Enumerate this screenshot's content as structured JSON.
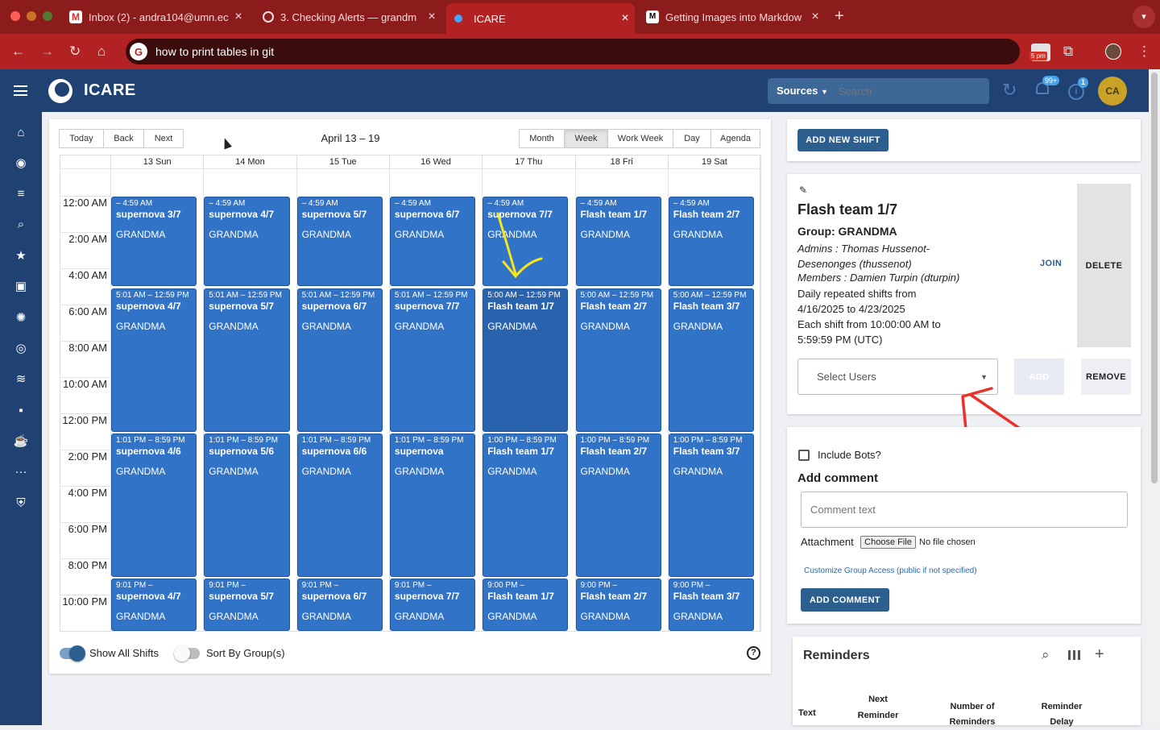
{
  "browser": {
    "tabs": [
      {
        "title": "Inbox (2) - andra104@umn.ec",
        "icon": "gmail-icon"
      },
      {
        "title": "3. Checking Alerts — grandm",
        "icon": "globe-icon"
      },
      {
        "title": "ICARE",
        "icon": "icare-icon"
      },
      {
        "title": "Getting Images into Markdow",
        "icon": "medium-icon"
      }
    ],
    "omnibox": "how to print tables in git",
    "omnibox_badge": "5 pm",
    "colors": {
      "frame": "#8c1c1c",
      "toolbar": "#b22222"
    }
  },
  "app": {
    "name": "ICARE",
    "sources_label": "Sources",
    "search_placeholder": "Search",
    "notifications_badge": "99+",
    "info_badge": "1",
    "avatar_initials": "CA",
    "colors": {
      "header": "#1f4272",
      "event": "#3173c6",
      "avatar": "#c9a227"
    }
  },
  "calendar": {
    "toolbar": {
      "today": "Today",
      "back": "Back",
      "next": "Next",
      "range": "April 13 – 19"
    },
    "views": [
      "Month",
      "Week",
      "Work Week",
      "Day",
      "Agenda"
    ],
    "active_view": "Week",
    "days": [
      "13 Sun",
      "14 Mon",
      "15 Tue",
      "16 Wed",
      "17 Thu",
      "18 Fri",
      "19 Sat"
    ],
    "times": [
      "12:00 AM",
      "2:00 AM",
      "4:00 AM",
      "6:00 AM",
      "8:00 AM",
      "10:00 AM",
      "12:00 PM",
      "2:00 PM",
      "4:00 PM",
      "6:00 PM",
      "8:00 PM",
      "10:00 PM"
    ],
    "events": [
      [
        {
          "time": "– 4:59 AM",
          "name": "supernova 3/7",
          "group": "GRANDMA"
        },
        {
          "time": "5:01 AM – 12:59 PM",
          "name": "supernova 4/7",
          "group": "GRANDMA"
        },
        {
          "time": "1:01 PM – 8:59 PM",
          "name": "supernova 4/6",
          "group": "GRANDMA"
        },
        {
          "time": "9:01 PM –",
          "name": "supernova 4/7",
          "group": "GRANDMA"
        }
      ],
      [
        {
          "time": "– 4:59 AM",
          "name": "supernova 4/7",
          "group": "GRANDMA"
        },
        {
          "time": "5:01 AM – 12:59 PM",
          "name": "supernova 5/7",
          "group": "GRANDMA"
        },
        {
          "time": "1:01 PM – 8:59 PM",
          "name": "supernova 5/6",
          "group": "GRANDMA"
        },
        {
          "time": "9:01 PM –",
          "name": "supernova 5/7",
          "group": "GRANDMA"
        }
      ],
      [
        {
          "time": "– 4:59 AM",
          "name": "supernova 5/7",
          "group": "GRANDMA"
        },
        {
          "time": "5:01 AM – 12:59 PM",
          "name": "supernova 6/7",
          "group": "GRANDMA"
        },
        {
          "time": "1:01 PM – 8:59 PM",
          "name": "supernova 6/6",
          "group": "GRANDMA"
        },
        {
          "time": "9:01 PM –",
          "name": "supernova 6/7",
          "group": "GRANDMA"
        }
      ],
      [
        {
          "time": "– 4:59 AM",
          "name": "supernova 6/7",
          "group": "GRANDMA"
        },
        {
          "time": "5:01 AM – 12:59 PM",
          "name": "supernova 7/7",
          "group": "GRANDMA"
        },
        {
          "time": "1:01 PM – 8:59 PM",
          "name": "supernova",
          "group": "GRANDMA"
        },
        {
          "time": "9:01 PM –",
          "name": "supernova 7/7",
          "group": "GRANDMA"
        }
      ],
      [
        {
          "time": "– 4:59 AM",
          "name": "supernova 7/7",
          "group": "GRANDMA"
        },
        {
          "time": "5:00 AM – 12:59 PM",
          "name": "Flash team 1/7",
          "group": "GRANDMA"
        },
        {
          "time": "1:00 PM – 8:59 PM",
          "name": "Flash team 1/7",
          "group": "GRANDMA"
        },
        {
          "time": "9:00 PM –",
          "name": "Flash team 1/7",
          "group": "GRANDMA"
        }
      ],
      [
        {
          "time": "– 4:59 AM",
          "name": "Flash team 1/7",
          "group": "GRANDMA"
        },
        {
          "time": "5:00 AM – 12:59 PM",
          "name": "Flash team 2/7",
          "group": "GRANDMA"
        },
        {
          "time": "1:00 PM – 8:59 PM",
          "name": "Flash team 2/7",
          "group": "GRANDMA"
        },
        {
          "time": "9:00 PM –",
          "name": "Flash team 2/7",
          "group": "GRANDMA"
        }
      ],
      [
        {
          "time": "– 4:59 AM",
          "name": "Flash team 2/7",
          "group": "GRANDMA"
        },
        {
          "time": "5:00 AM – 12:59 PM",
          "name": "Flash team 3/7",
          "group": "GRANDMA"
        },
        {
          "time": "1:00 PM – 8:59 PM",
          "name": "Flash team 3/7",
          "group": "GRANDMA"
        },
        {
          "time": "9:00 PM –",
          "name": "Flash team 3/7",
          "group": "GRANDMA"
        }
      ]
    ],
    "show_all_shifts": {
      "label": "Show All Shifts",
      "on": true
    },
    "sort_by_groups": {
      "label": "Sort By Group(s)",
      "on": false
    }
  },
  "shift_panel": {
    "add_new_shift": "ADD NEW SHIFT",
    "title": "Flash team 1/7",
    "group": "Group: GRANDMA",
    "admins": "Admins : Thomas Hussenot-Desenonges (thussenot)",
    "members": "Members : Damien Turpin (dturpin)",
    "repeat_line1": "Daily repeated shifts from",
    "repeat_line2": "4/16/2025 to 4/23/2025",
    "repeat_line3": "Each shift from 10:00:00 AM to",
    "repeat_line4": "5:59:59 PM (UTC)",
    "join": "JOIN",
    "delete": "DELETE",
    "select_users_placeholder": "Select Users",
    "add": "ADD",
    "remove": "REMOVE"
  },
  "comment_panel": {
    "include_bots": "Include Bots?",
    "heading": "Add comment",
    "comment_placeholder": "Comment text",
    "attachment_label": "Attachment",
    "choose_file": "Choose File",
    "no_file": "No file chosen",
    "customize_access": "Customize Group Access (public if not specified)",
    "add_comment": "ADD COMMENT"
  },
  "reminders": {
    "title": "Reminders",
    "columns": [
      "Text",
      "Next Reminder",
      "Number of Reminders",
      "Reminder Delay"
    ]
  }
}
